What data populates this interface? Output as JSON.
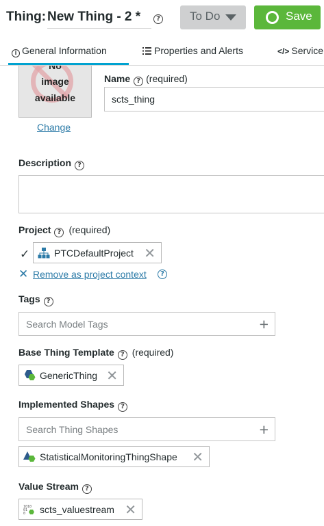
{
  "header": {
    "title_prefix": "Thing:",
    "title_name": "New Thing - 2 *",
    "state_button": "To Do",
    "save_button": "Save"
  },
  "tabs": [
    {
      "label": "General Information",
      "icon": "info-icon",
      "active": true
    },
    {
      "label": "Properties and Alerts",
      "icon": "list-icon",
      "active": false
    },
    {
      "label": "Service",
      "icon": "code-icon",
      "active": false
    }
  ],
  "image": {
    "placeholder_lines": [
      "No",
      "image",
      "available"
    ],
    "change_link": "Change"
  },
  "name": {
    "label": "Name",
    "required": "(required)",
    "value": "scts_thing"
  },
  "description": {
    "label": "Description",
    "value": ""
  },
  "project": {
    "label": "Project",
    "required": "(required)",
    "value": "PTCDefaultProject",
    "remove_context_link": "Remove as project context"
  },
  "tags": {
    "label": "Tags",
    "placeholder": "Search Model Tags"
  },
  "base_thing_template": {
    "label": "Base Thing Template",
    "required": "(required)",
    "value": "GenericThing"
  },
  "implemented_shapes": {
    "label": "Implemented Shapes",
    "placeholder": "Search Thing Shapes",
    "value": "StatisticalMonitoringThingShape"
  },
  "value_stream": {
    "label": "Value Stream",
    "value": "scts_valuestream"
  },
  "colors": {
    "accent": "#00a2d0",
    "save": "#5bb73b",
    "link": "#2b7aa7"
  }
}
